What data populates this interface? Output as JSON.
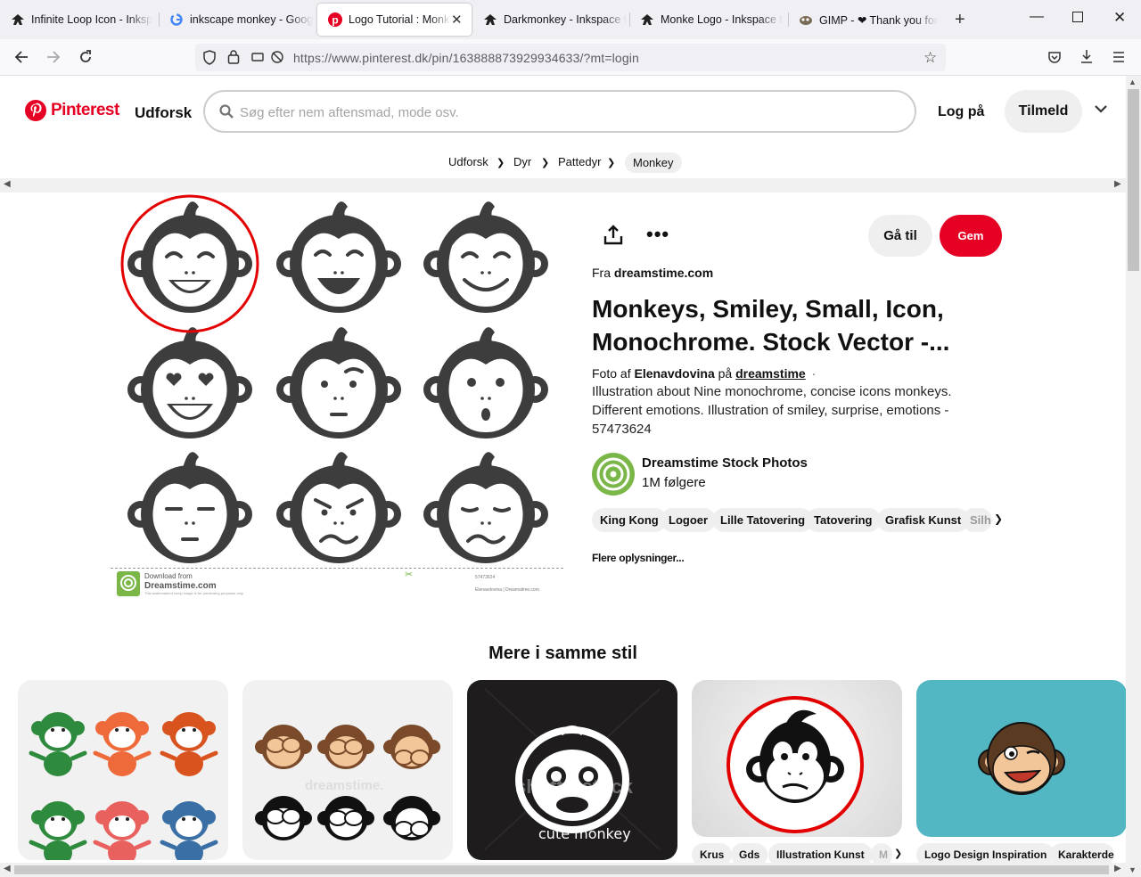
{
  "tabs": [
    {
      "title": "Infinite Loop Icon - Inksp",
      "icon": "inkscape-icon"
    },
    {
      "title": "inkscape monkey - Goog",
      "icon": "google-icon"
    },
    {
      "title": "Logo Tutorial : Monkey",
      "icon": "pinterest-icon",
      "active": true
    },
    {
      "title": "Darkmonkey - Inkspace t",
      "icon": "inkscape-icon"
    },
    {
      "title": "Monke Logo - Inkspace t",
      "icon": "inkscape-icon"
    },
    {
      "title": "GIMP - ❤ Thank you for",
      "icon": "gimp-icon"
    }
  ],
  "url": "https://www.pinterest.dk/pin/163888873929934633/?mt=login",
  "header": {
    "brand": "Pinterest",
    "explore": "Udforsk",
    "search_placeholder": "Søg efter nem aftensmad, mode osv.",
    "login": "Log på",
    "signup": "Tilmeld"
  },
  "breadcrumb": [
    "Udforsk",
    "Dyr",
    "Pattedyr",
    "Monkey"
  ],
  "pin": {
    "goto": "Gå til",
    "save": "Gem",
    "from_prefix": "Fra",
    "from_site": "dreamstime.com",
    "title": "Monkeys, Smiley, Small, Icon, Monochrome. Stock Vector -...",
    "photo_prefix": "Foto af",
    "photographer": "Elenavdovina",
    "on": "på",
    "site_link": "dreamstime",
    "dot": "·",
    "description": "Illustration about Nine monochrome, concise icons monkeys. Different emotions. Illustration of smiley, surprise, emotions - 57473624",
    "creator_name": "Dreamstime Stock Photos",
    "followers": "1M følgere",
    "tags": [
      "King Kong",
      "Logoer",
      "Lille Tatovering",
      "Tatovering",
      "Grafisk Kunst",
      "Silh"
    ],
    "more_info": "Flere oplysninger...",
    "image_footer": {
      "download": "Download from",
      "brand": "Dreamstime.com",
      "fine": "This watermarked comp image is for previewing purposes only.",
      "id": "57473624",
      "credit": "Elenavdovina | Dreamstime.com"
    }
  },
  "related": {
    "heading": "Mere i samme stil",
    "card3_caption": "cute monkey",
    "card3_watermark": "shutterstock",
    "card2_watermark": "dreamstime.",
    "card4_tags": [
      "Krus",
      "Gds",
      "Illustration Kunst",
      "M"
    ],
    "card5_tags": [
      "Logo Design Inspiration",
      "Karakterde"
    ]
  },
  "colors": {
    "brand_red": "#e60023",
    "pill_bg": "#efefef",
    "teal": "#52b6c3"
  }
}
